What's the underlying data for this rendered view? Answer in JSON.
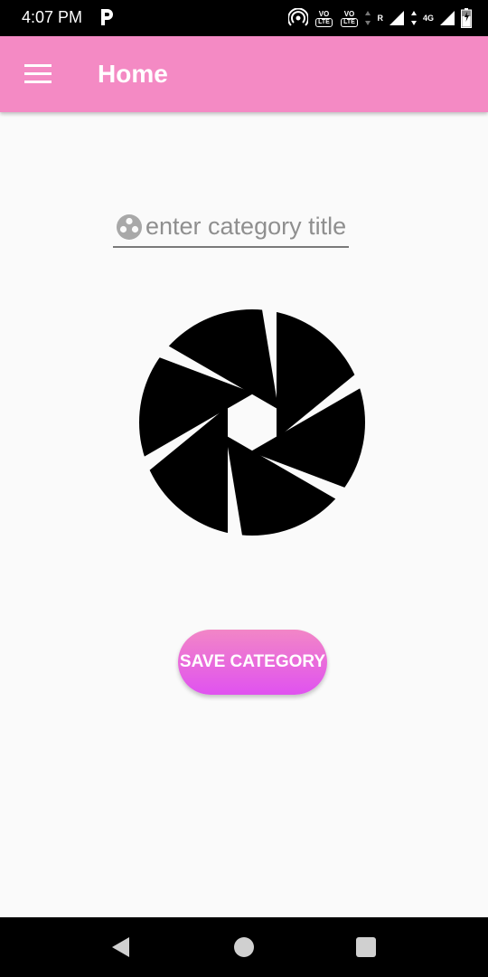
{
  "status_bar": {
    "time": "4:07 PM",
    "sim1_label": "VO",
    "sim1_sub": "LTE",
    "sim2_label": "VO",
    "sim2_sub": "LTE",
    "roaming_label": "R",
    "network_label": "4G",
    "icons": [
      "parking-app-icon",
      "hotspot-icon",
      "volte-sim1-icon",
      "volte-sim2-icon",
      "signal-icon",
      "battery-icon"
    ]
  },
  "app_bar": {
    "title": "Home",
    "menu_icon": "hamburger-menu-icon",
    "background_color": "#f48ac4"
  },
  "form": {
    "title_input": {
      "placeholder": "enter category title",
      "value": "",
      "icon": "category-icon"
    },
    "category_image": {
      "icon": "camera-aperture-icon"
    },
    "save_button": {
      "label": "SAVE CATEGORY",
      "gradient_top": "#f286c6",
      "gradient_bottom": "#e052f0"
    }
  },
  "nav_bar": {
    "back_icon": "back-icon",
    "home_icon": "home-icon",
    "recents_icon": "recents-icon"
  }
}
